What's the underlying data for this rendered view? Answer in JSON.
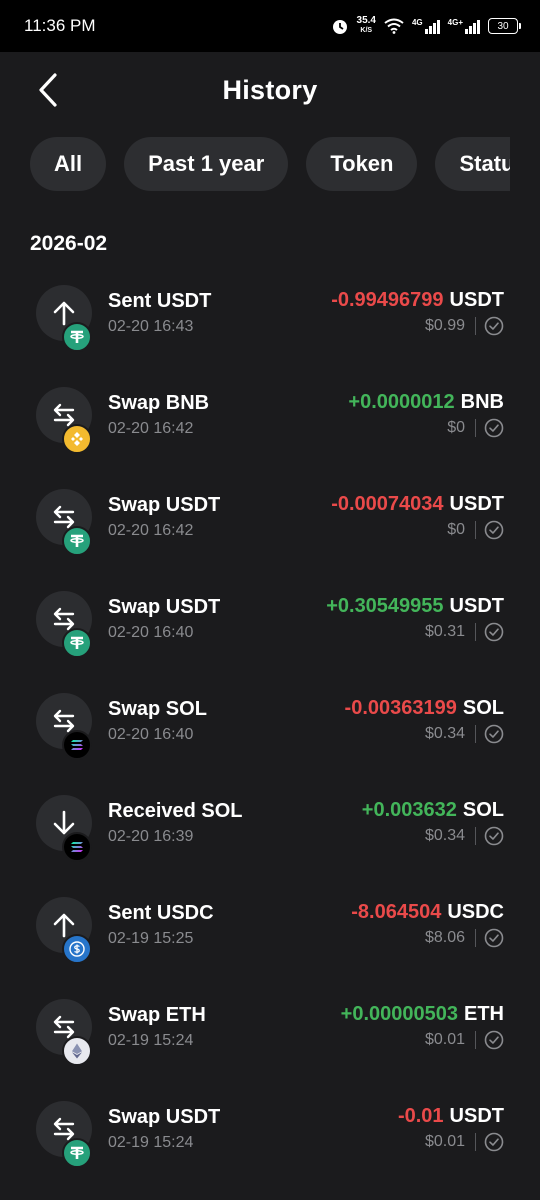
{
  "status_bar": {
    "time": "11:36 PM",
    "net_speed": "35.4",
    "net_unit": "K/S",
    "sim1": "4G",
    "sim2": "4G+",
    "battery": "30"
  },
  "header": {
    "title": "History",
    "back_icon": "chevron-left-icon"
  },
  "filters": [
    "All",
    "Past 1 year",
    "Token",
    "Status"
  ],
  "section": {
    "month": "2026-02"
  },
  "colors": {
    "negative": "#ea4a4a",
    "positive": "#43b55a",
    "usdt": "#26a17b",
    "bnb": "#f3ba2f",
    "usdc": "#2775ca",
    "sol": "#000000",
    "eth": "#8a92b2"
  },
  "transactions": [
    {
      "type": "sent",
      "title": "Sent USDT",
      "time": "02-20 16:43",
      "amount": "-0.99496799",
      "symbol": "USDT",
      "fiat": "$0.99",
      "token": "usdt",
      "status": "success"
    },
    {
      "type": "swap",
      "title": "Swap BNB",
      "time": "02-20 16:42",
      "amount": "+0.0000012",
      "symbol": "BNB",
      "fiat": "$0",
      "token": "bnb",
      "status": "success"
    },
    {
      "type": "swap",
      "title": "Swap USDT",
      "time": "02-20 16:42",
      "amount": "-0.00074034",
      "symbol": "USDT",
      "fiat": "$0",
      "token": "usdt",
      "status": "success"
    },
    {
      "type": "swap",
      "title": "Swap USDT",
      "time": "02-20 16:40",
      "amount": "+0.30549955",
      "symbol": "USDT",
      "fiat": "$0.31",
      "token": "usdt",
      "status": "success"
    },
    {
      "type": "swap",
      "title": "Swap SOL",
      "time": "02-20 16:40",
      "amount": "-0.00363199",
      "symbol": "SOL",
      "fiat": "$0.34",
      "token": "sol",
      "status": "success"
    },
    {
      "type": "received",
      "title": "Received SOL",
      "time": "02-20 16:39",
      "amount": "+0.003632",
      "symbol": "SOL",
      "fiat": "$0.34",
      "token": "sol",
      "status": "success"
    },
    {
      "type": "sent",
      "title": "Sent USDC",
      "time": "02-19 15:25",
      "amount": "-8.064504",
      "symbol": "USDC",
      "fiat": "$8.06",
      "token": "usdc",
      "status": "success"
    },
    {
      "type": "swap",
      "title": "Swap ETH",
      "time": "02-19 15:24",
      "amount": "+0.00000503",
      "symbol": "ETH",
      "fiat": "$0.01",
      "token": "eth",
      "status": "success"
    },
    {
      "type": "swap",
      "title": "Swap USDT",
      "time": "02-19 15:24",
      "amount": "-0.01",
      "symbol": "USDT",
      "fiat": "$0.01",
      "token": "usdt",
      "status": "success"
    }
  ]
}
